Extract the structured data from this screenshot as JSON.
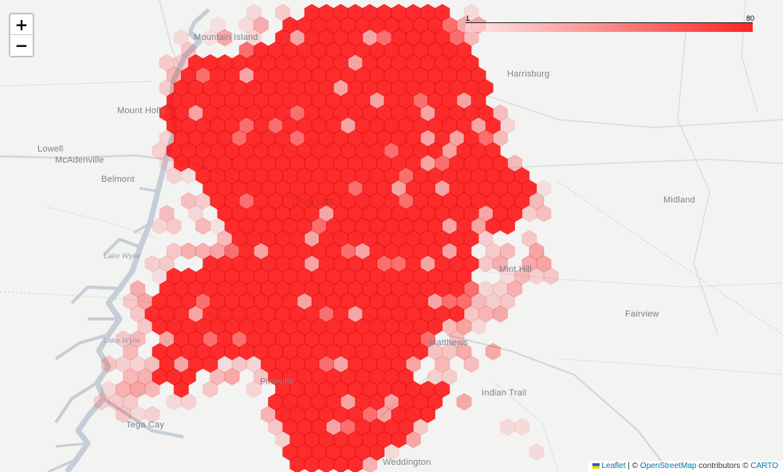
{
  "map": {
    "legend": {
      "min_label": "1",
      "max_label": "80",
      "min": 1,
      "max": 80,
      "color": "#ff0000"
    },
    "places": [
      {
        "key": "mountain-island",
        "label": "Mountain Island"
      },
      {
        "key": "harrisburg",
        "label": "Harrisburg"
      },
      {
        "key": "mount-holly",
        "label": "Mount Holly"
      },
      {
        "key": "lowell",
        "label": "Lowell"
      },
      {
        "key": "mcadenville",
        "label": "McAdenville"
      },
      {
        "key": "belmont",
        "label": "Belmont"
      },
      {
        "key": "charlotte",
        "label": "Charlotte"
      },
      {
        "key": "midland",
        "label": "Midland"
      },
      {
        "key": "lake-wylie-1",
        "label": "Lake Wylie"
      },
      {
        "key": "mint-hill",
        "label": "Mint Hill"
      },
      {
        "key": "fairview",
        "label": "Fairview"
      },
      {
        "key": "lake-wylie-2",
        "label": "Lake Wylie"
      },
      {
        "key": "matthews",
        "label": "Matthews"
      },
      {
        "key": "indian-trail",
        "label": "Indian Trail"
      },
      {
        "key": "pineville",
        "label": "Pineville"
      },
      {
        "key": "tega-cay",
        "label": "Tega Cay"
      },
      {
        "key": "weddington",
        "label": "Weddington"
      }
    ]
  },
  "controls": {
    "zoom_in": "+",
    "zoom_out": "−"
  },
  "attribution": {
    "leaflet": "Leaflet",
    "sep": " | © ",
    "osm": "OpenStreetMap",
    "contrib": " contributors © ",
    "carto": "CARTO"
  }
}
